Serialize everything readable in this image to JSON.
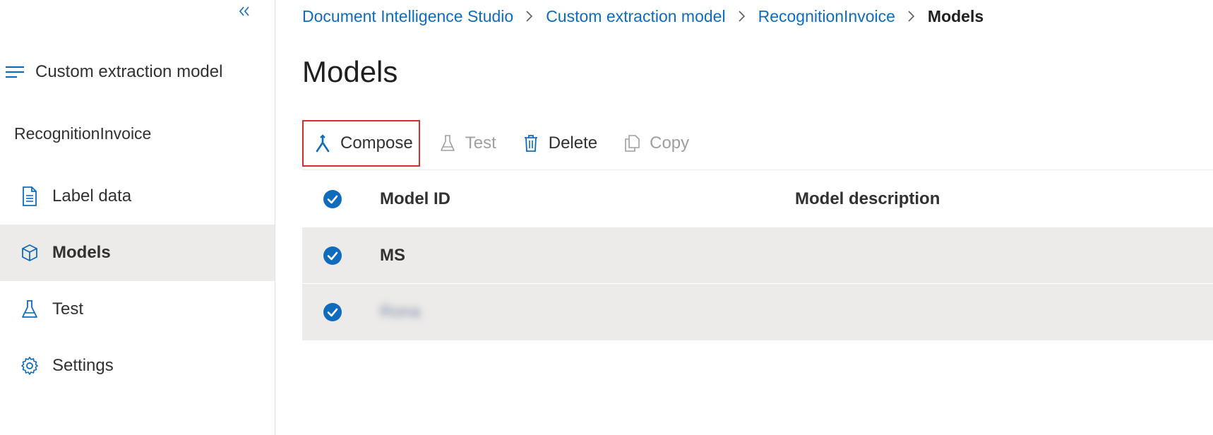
{
  "sidebar": {
    "collapse_icon": "double-chevron-left-icon",
    "header": {
      "label": "Custom extraction model",
      "icon": "hamburger-icon"
    },
    "section_title": "RecognitionInvoice",
    "items": [
      {
        "label": "Label data",
        "icon": "document-icon",
        "active": false
      },
      {
        "label": "Models",
        "icon": "cube-icon",
        "active": true
      },
      {
        "label": "Test",
        "icon": "flask-icon",
        "active": false
      },
      {
        "label": "Settings",
        "icon": "gear-icon",
        "active": false
      }
    ]
  },
  "breadcrumb": {
    "items": [
      "Document Intelligence Studio",
      "Custom extraction model",
      "RecognitionInvoice"
    ],
    "current": "Models"
  },
  "page": {
    "title": "Models"
  },
  "toolbar": {
    "compose_label": "Compose",
    "test_label": "Test",
    "delete_label": "Delete",
    "copy_label": "Copy"
  },
  "table": {
    "columns": [
      "Model ID",
      "Model description"
    ],
    "rows": [
      {
        "model_id": "MS",
        "description": "",
        "selected": true
      },
      {
        "model_id": "Rona",
        "description": "",
        "selected": true
      }
    ]
  },
  "colors": {
    "accent": "#0f6cbd",
    "highlight_border": "#d32f2f",
    "selected_row_bg": "#edebe9"
  }
}
